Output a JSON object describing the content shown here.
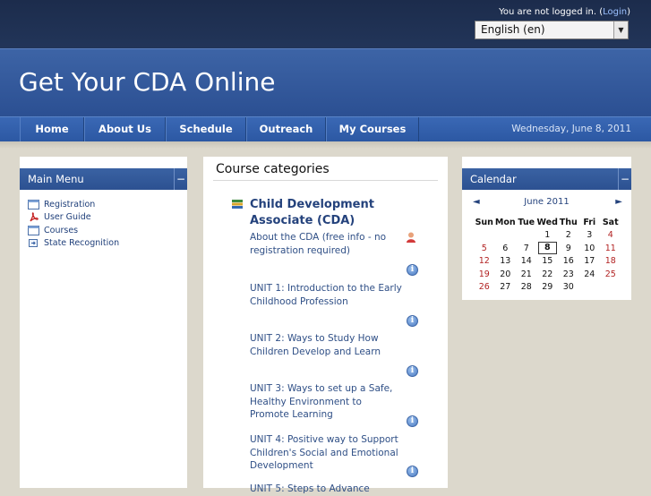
{
  "topbar": {
    "login_text": "You are not logged in. (",
    "login_link": "Login",
    "login_close": ")",
    "language": "English (en)"
  },
  "header": {
    "site_title": "Get Your CDA Online"
  },
  "nav": {
    "items": [
      "Home",
      "About Us",
      "Schedule",
      "Outreach",
      "My Courses"
    ],
    "date": "Wednesday, June 8, 2011"
  },
  "main_menu": {
    "title": "Main Menu",
    "items": [
      {
        "label": "Registration",
        "icon": "window-icon"
      },
      {
        "label": "User Guide",
        "icon": "pdf-icon"
      },
      {
        "label": "Courses",
        "icon": "window-icon"
      },
      {
        "label": "State Recognition",
        "icon": "link-icon"
      }
    ]
  },
  "center": {
    "heading": "Course categories",
    "category": "Child Development Associate (CDA)",
    "courses": [
      "About the CDA (free info - no registration required)",
      "UNIT 1: Introduction to the Early Childhood Profession",
      "UNIT 2: Ways to Study How Children Develop and Learn",
      "UNIT 3: Ways to set up a Safe, Healthy Environment to Promote Learning",
      "UNIT 4: Positive way to Support Children's Social and Emotional Development",
      "UNIT 5: Steps to Advance"
    ]
  },
  "calendar": {
    "title": "Calendar",
    "month": "June 2011",
    "prev": "◄",
    "next": "►",
    "days": [
      "Sun",
      "Mon",
      "Tue",
      "Wed",
      "Thu",
      "Fri",
      "Sat"
    ],
    "weeks": [
      [
        "",
        "",
        "",
        "1",
        "2",
        "3",
        "4"
      ],
      [
        "5",
        "6",
        "7",
        "8",
        "9",
        "10",
        "11"
      ],
      [
        "12",
        "13",
        "14",
        "15",
        "16",
        "17",
        "18"
      ],
      [
        "19",
        "20",
        "21",
        "22",
        "23",
        "24",
        "25"
      ],
      [
        "26",
        "27",
        "28",
        "29",
        "30",
        "",
        ""
      ]
    ],
    "today": "8"
  },
  "colors": {
    "topbar": "#1c2c4c",
    "header": "#3d64a6",
    "nav": "#3a68b5",
    "link": "#2f4f86",
    "weekend": "#b22222"
  }
}
